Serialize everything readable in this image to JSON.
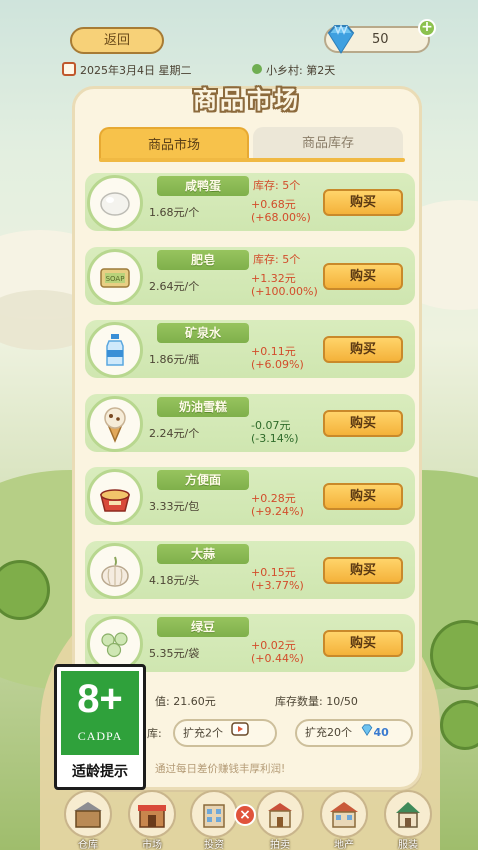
{
  "header": {
    "back_label": "返回",
    "gems": "50",
    "gem_add_label": "+",
    "date": "2025年3月4日 星期二",
    "town": "小乡村: 第2天"
  },
  "market": {
    "title": "商品市场",
    "tabs": [
      {
        "label": "商品市场",
        "active": true
      },
      {
        "label": "商品库存",
        "active": false
      }
    ],
    "buy_label": "购买",
    "items": [
      {
        "name": "咸鸭蛋",
        "icon": "salted-egg-icon",
        "price": "1.68元/个",
        "stock": "库存: 5个",
        "change": "+0.68元",
        "change_pct": "(+68.00%)",
        "trend": "up"
      },
      {
        "name": "肥皂",
        "icon": "soap-icon",
        "price": "2.64元/个",
        "stock": "库存: 5个",
        "change": "+1.32元",
        "change_pct": "(+100.00%)",
        "trend": "up"
      },
      {
        "name": "矿泉水",
        "icon": "water-bottle-icon",
        "price": "1.86元/瓶",
        "stock": "",
        "change": "+0.11元",
        "change_pct": "(+6.09%)",
        "trend": "up"
      },
      {
        "name": "奶油雪糕",
        "icon": "ice-cream-icon",
        "price": "2.24元/个",
        "stock": "",
        "change": "-0.07元",
        "change_pct": "(-3.14%)",
        "trend": "down"
      },
      {
        "name": "方便面",
        "icon": "instant-noodles-icon",
        "price": "3.33元/包",
        "stock": "",
        "change": "+0.28元",
        "change_pct": "(+9.24%)",
        "trend": "up"
      },
      {
        "name": "大蒜",
        "icon": "garlic-icon",
        "price": "4.18元/头",
        "stock": "",
        "change": "+0.15元",
        "change_pct": "(+3.77%)",
        "trend": "up"
      },
      {
        "name": "绿豆",
        "icon": "mung-bean-icon",
        "price": "5.35元/袋",
        "stock": "",
        "change": "+0.02元",
        "change_pct": "(+0.44%)",
        "trend": "up"
      }
    ],
    "footer": {
      "value_label": "值: 21.60元",
      "stock_count": "库存数量: 10/50",
      "warehouse_label": "库:",
      "expand2_label": "扩充2个",
      "expand20_label": "扩充20个",
      "expand20_cost": "40",
      "hint": "通过每日差价赚钱丰厚利润!"
    }
  },
  "nav": {
    "items": [
      {
        "label": "仓库",
        "icon": "warehouse-icon"
      },
      {
        "label": "市场",
        "icon": "market-icon"
      },
      {
        "label": "投资",
        "icon": "invest-icon"
      },
      {
        "label": "拍卖",
        "icon": "auction-icon"
      },
      {
        "label": "地产",
        "icon": "property-icon"
      },
      {
        "label": "服装",
        "icon": "clothing-icon"
      }
    ],
    "close_label": "×"
  },
  "age_rating": {
    "age": "8+",
    "org": "CADPA",
    "tip": "适龄提示"
  },
  "colors": {
    "up": "#d24d2b",
    "down": "#2f6b2a",
    "accent": "#f7c24b",
    "row_bg": "#d9ecbd"
  }
}
